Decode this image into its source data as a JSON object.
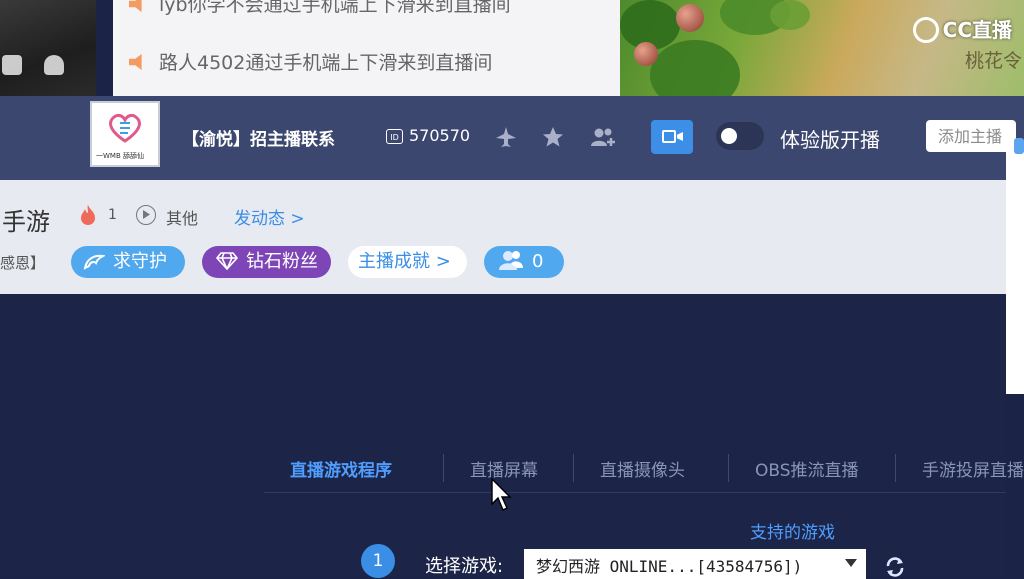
{
  "chat": {
    "lines": [
      "lyb你学不会通过手机端上下滑来到直播间",
      "路人4502通过手机端上下滑来到直播间"
    ]
  },
  "video": {
    "logo": "CC直播",
    "subtitle": "桃花令"
  },
  "header": {
    "avatar_caption": "一WMB 舔舔仙",
    "room_title": "【渝悦】招主播联系",
    "room_id_badge": "ID",
    "room_id": "570570",
    "trial_label": "体验版开播",
    "add_placeholder": "添加主播"
  },
  "info": {
    "game_name": "手游",
    "fire_count": "1",
    "category": "其他",
    "post_link": "发动态 >",
    "thanks_text": "感恩】",
    "guard_label": "求守护",
    "diamond_label": "钻石粉丝",
    "achievement_label": "主播成就 >",
    "fans_count": "0"
  },
  "setup": {
    "tabs": [
      {
        "label": "直播游戏程序",
        "active": true
      },
      {
        "label": "直播屏幕",
        "active": false
      },
      {
        "label": "直播摄像头",
        "active": false
      },
      {
        "label": "OBS推流直播",
        "active": false
      },
      {
        "label": "手游投屏直播",
        "active": false
      }
    ],
    "supported_games": "支持的游戏",
    "step_number": "1",
    "select_label": "选择游戏:",
    "selected_game": "梦幻西游 ONLINE...[43584756])"
  },
  "colors": {
    "accent_blue": "#3a8ee6",
    "header_bg": "#3c4770",
    "setup_bg": "#1c2447",
    "diamond_purple": "#7e45b6"
  }
}
